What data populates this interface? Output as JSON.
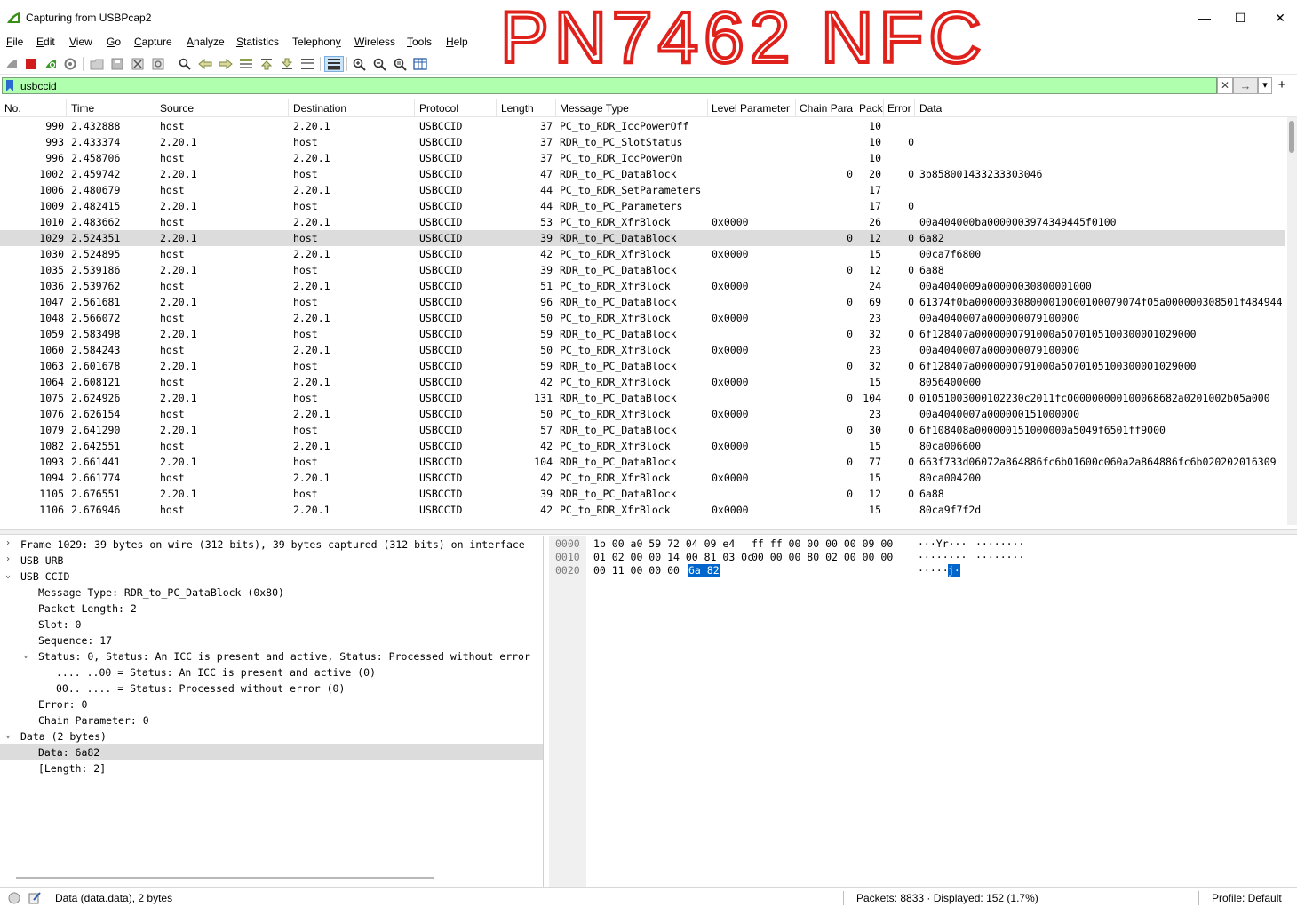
{
  "window": {
    "title": "Capturing from USBPcap2",
    "minimize_glyph": "—",
    "maximize_glyph": "☐",
    "close_glyph": "✕",
    "annotation": "PN7462 NFC"
  },
  "menu": {
    "items": [
      {
        "key": "F",
        "rest": "ile"
      },
      {
        "key": "E",
        "rest": "dit"
      },
      {
        "key": "V",
        "rest": "iew"
      },
      {
        "key": "G",
        "rest": "o"
      },
      {
        "key": "C",
        "rest": "apture"
      },
      {
        "key": "A",
        "rest": "nalyze"
      },
      {
        "key": "S",
        "rest": "tatistics"
      },
      {
        "key": "",
        "rest": "Telephon",
        "key2": "y"
      },
      {
        "key": "W",
        "rest": "ireless"
      },
      {
        "key": "T",
        "rest": "ools"
      },
      {
        "key": "H",
        "rest": "elp"
      }
    ]
  },
  "toolbar": {
    "icons": [
      "shark-fin-icon",
      "stop-icon",
      "restart-icon",
      "options-gear-icon",
      "open-folder-icon",
      "save-icon",
      "close-file-icon",
      "reload-icon",
      "find-icon",
      "back-icon",
      "forward-icon",
      "goto-icon",
      "first-icon",
      "last-icon",
      "autoscroll-icon",
      "colorize-icon",
      "zoom-in-icon",
      "zoom-out-icon",
      "zoom-normal-icon",
      "resize-columns-icon"
    ]
  },
  "filter": {
    "value": "usbccid",
    "clear_glyph": "✕",
    "apply_glyph": "→",
    "dropdown_glyph": "▾",
    "add_glyph": "+"
  },
  "packet_list": {
    "columns": [
      "No.",
      "Time",
      "Source",
      "Destination",
      "Protocol",
      "Length",
      "Message Type",
      "Level Parameter",
      "Chain Parar",
      "Pack",
      "Error",
      "Data"
    ],
    "rows": [
      {
        "no": "990",
        "time": "2.432888",
        "src": "host",
        "dst": "2.20.1",
        "proto": "USBCCID",
        "len": "37",
        "type": "PC_to_RDR_IccPowerOff",
        "level": "",
        "chain": "",
        "pack": "10",
        "error": "",
        "data": ""
      },
      {
        "no": "993",
        "time": "2.433374",
        "src": "2.20.1",
        "dst": "host",
        "proto": "USBCCID",
        "len": "37",
        "type": "RDR_to_PC_SlotStatus",
        "level": "",
        "chain": "",
        "pack": "10",
        "error": "0",
        "data": ""
      },
      {
        "no": "996",
        "time": "2.458706",
        "src": "host",
        "dst": "2.20.1",
        "proto": "USBCCID",
        "len": "37",
        "type": "PC_to_RDR_IccPowerOn",
        "level": "",
        "chain": "",
        "pack": "10",
        "error": "",
        "data": ""
      },
      {
        "no": "1002",
        "time": "2.459742",
        "src": "2.20.1",
        "dst": "host",
        "proto": "USBCCID",
        "len": "47",
        "type": "RDR_to_PC_DataBlock",
        "level": "",
        "chain": "0",
        "pack": "20",
        "error": "0",
        "data": "3b858001433233303046"
      },
      {
        "no": "1006",
        "time": "2.480679",
        "src": "host",
        "dst": "2.20.1",
        "proto": "USBCCID",
        "len": "44",
        "type": "PC_to_RDR_SetParameters",
        "level": "",
        "chain": "",
        "pack": "17",
        "error": "",
        "data": ""
      },
      {
        "no": "1009",
        "time": "2.482415",
        "src": "2.20.1",
        "dst": "host",
        "proto": "USBCCID",
        "len": "44",
        "type": "RDR_to_PC_Parameters",
        "level": "",
        "chain": "",
        "pack": "17",
        "error": "0",
        "data": ""
      },
      {
        "no": "1010",
        "time": "2.483662",
        "src": "host",
        "dst": "2.20.1",
        "proto": "USBCCID",
        "len": "53",
        "type": "PC_to_RDR_XfrBlock",
        "level": "0x0000",
        "chain": "",
        "pack": "26",
        "error": "",
        "data": "00a404000ba0000003974349445f0100"
      },
      {
        "no": "1029",
        "time": "2.524351",
        "src": "2.20.1",
        "dst": "host",
        "proto": "USBCCID",
        "len": "39",
        "type": "RDR_to_PC_DataBlock",
        "level": "",
        "chain": "0",
        "pack": "12",
        "error": "0",
        "data": "6a82"
      },
      {
        "no": "1030",
        "time": "2.524895",
        "src": "host",
        "dst": "2.20.1",
        "proto": "USBCCID",
        "len": "42",
        "type": "PC_to_RDR_XfrBlock",
        "level": "0x0000",
        "chain": "",
        "pack": "15",
        "error": "",
        "data": "00ca7f6800"
      },
      {
        "no": "1035",
        "time": "2.539186",
        "src": "2.20.1",
        "dst": "host",
        "proto": "USBCCID",
        "len": "39",
        "type": "RDR_to_PC_DataBlock",
        "level": "",
        "chain": "0",
        "pack": "12",
        "error": "0",
        "data": "6a88"
      },
      {
        "no": "1036",
        "time": "2.539762",
        "src": "host",
        "dst": "2.20.1",
        "proto": "USBCCID",
        "len": "51",
        "type": "PC_to_RDR_XfrBlock",
        "level": "0x0000",
        "chain": "",
        "pack": "24",
        "error": "",
        "data": "00a4040009a00000030800001000"
      },
      {
        "no": "1047",
        "time": "2.561681",
        "src": "2.20.1",
        "dst": "host",
        "proto": "USBCCID",
        "len": "96",
        "type": "RDR_to_PC_DataBlock",
        "level": "",
        "chain": "0",
        "pack": "69",
        "error": "0",
        "data": "61374f0ba000000308000010000100079074f05a000000308501f484944"
      },
      {
        "no": "1048",
        "time": "2.566072",
        "src": "host",
        "dst": "2.20.1",
        "proto": "USBCCID",
        "len": "50",
        "type": "PC_to_RDR_XfrBlock",
        "level": "0x0000",
        "chain": "",
        "pack": "23",
        "error": "",
        "data": "00a4040007a000000079100000"
      },
      {
        "no": "1059",
        "time": "2.583498",
        "src": "2.20.1",
        "dst": "host",
        "proto": "USBCCID",
        "len": "59",
        "type": "RDR_to_PC_DataBlock",
        "level": "",
        "chain": "0",
        "pack": "32",
        "error": "0",
        "data": "6f128407a0000000791000a5070105100300001029000"
      },
      {
        "no": "1060",
        "time": "2.584243",
        "src": "host",
        "dst": "2.20.1",
        "proto": "USBCCID",
        "len": "50",
        "type": "PC_to_RDR_XfrBlock",
        "level": "0x0000",
        "chain": "",
        "pack": "23",
        "error": "",
        "data": "00a4040007a000000079100000"
      },
      {
        "no": "1063",
        "time": "2.601678",
        "src": "2.20.1",
        "dst": "host",
        "proto": "USBCCID",
        "len": "59",
        "type": "RDR_to_PC_DataBlock",
        "level": "",
        "chain": "0",
        "pack": "32",
        "error": "0",
        "data": "6f128407a0000000791000a5070105100300001029000"
      },
      {
        "no": "1064",
        "time": "2.608121",
        "src": "host",
        "dst": "2.20.1",
        "proto": "USBCCID",
        "len": "42",
        "type": "PC_to_RDR_XfrBlock",
        "level": "0x0000",
        "chain": "",
        "pack": "15",
        "error": "",
        "data": "8056400000"
      },
      {
        "no": "1075",
        "time": "2.624926",
        "src": "2.20.1",
        "dst": "host",
        "proto": "USBCCID",
        "len": "131",
        "type": "RDR_to_PC_DataBlock",
        "level": "",
        "chain": "0",
        "pack": "104",
        "error": "0",
        "data": "01051003000102230c2011fc000000000100068682a0201002b05a000"
      },
      {
        "no": "1076",
        "time": "2.626154",
        "src": "host",
        "dst": "2.20.1",
        "proto": "USBCCID",
        "len": "50",
        "type": "PC_to_RDR_XfrBlock",
        "level": "0x0000",
        "chain": "",
        "pack": "23",
        "error": "",
        "data": "00a4040007a000000151000000"
      },
      {
        "no": "1079",
        "time": "2.641290",
        "src": "2.20.1",
        "dst": "host",
        "proto": "USBCCID",
        "len": "57",
        "type": "RDR_to_PC_DataBlock",
        "level": "",
        "chain": "0",
        "pack": "30",
        "error": "0",
        "data": "6f108408a000000151000000a5049f6501ff9000"
      },
      {
        "no": "1082",
        "time": "2.642551",
        "src": "host",
        "dst": "2.20.1",
        "proto": "USBCCID",
        "len": "42",
        "type": "PC_to_RDR_XfrBlock",
        "level": "0x0000",
        "chain": "",
        "pack": "15",
        "error": "",
        "data": "80ca006600"
      },
      {
        "no": "1093",
        "time": "2.661441",
        "src": "2.20.1",
        "dst": "host",
        "proto": "USBCCID",
        "len": "104",
        "type": "RDR_to_PC_DataBlock",
        "level": "",
        "chain": "0",
        "pack": "77",
        "error": "0",
        "data": "663f733d06072a864886fc6b01600c060a2a864886fc6b020202016309"
      },
      {
        "no": "1094",
        "time": "2.661774",
        "src": "host",
        "dst": "2.20.1",
        "proto": "USBCCID",
        "len": "42",
        "type": "PC_to_RDR_XfrBlock",
        "level": "0x0000",
        "chain": "",
        "pack": "15",
        "error": "",
        "data": "80ca004200"
      },
      {
        "no": "1105",
        "time": "2.676551",
        "src": "2.20.1",
        "dst": "host",
        "proto": "USBCCID",
        "len": "39",
        "type": "RDR_to_PC_DataBlock",
        "level": "",
        "chain": "0",
        "pack": "12",
        "error": "0",
        "data": "6a88"
      },
      {
        "no": "1106",
        "time": "2.676946",
        "src": "host",
        "dst": "2.20.1",
        "proto": "USBCCID",
        "len": "42",
        "type": "PC_to_RDR_XfrBlock",
        "level": "0x0000",
        "chain": "",
        "pack": "15",
        "error": "",
        "data": "80ca9f7f2d"
      }
    ]
  },
  "details": {
    "lines": [
      {
        "indent": 0,
        "arrow": "›",
        "text": "Frame 1029: 39 bytes on wire (312 bits), 39 bytes captured (312 bits) on interface"
      },
      {
        "indent": 0,
        "arrow": "›",
        "text": "USB URB"
      },
      {
        "indent": 0,
        "arrow": "⌄",
        "text": "USB CCID"
      },
      {
        "indent": 1,
        "arrow": "",
        "text": "Message Type: RDR_to_PC_DataBlock (0x80)"
      },
      {
        "indent": 1,
        "arrow": "",
        "text": "Packet Length: 2"
      },
      {
        "indent": 1,
        "arrow": "",
        "text": "Slot: 0"
      },
      {
        "indent": 1,
        "arrow": "",
        "text": "Sequence: 17"
      },
      {
        "indent": 1,
        "arrow": "⌄",
        "text": "Status: 0, Status: An ICC is present and active, Status: Processed without error"
      },
      {
        "indent": 2,
        "arrow": "",
        "text": ".... ..00 = Status: An ICC is present and active (0)"
      },
      {
        "indent": 2,
        "arrow": "",
        "text": "00.. .... = Status: Processed without error  (0)"
      },
      {
        "indent": 1,
        "arrow": "",
        "text": "Error: 0"
      },
      {
        "indent": 1,
        "arrow": "",
        "text": "Chain Parameter: 0"
      },
      {
        "indent": 0,
        "arrow": "⌄",
        "text": "Data (2 bytes)"
      },
      {
        "indent": 1,
        "arrow": "",
        "text": "Data: 6a82"
      },
      {
        "indent": 1,
        "arrow": "",
        "text": "[Length: 2]"
      }
    ]
  },
  "bytes": {
    "rows": [
      {
        "offset": "0000",
        "hex1": "1b 00 a0 59 72 04 09 e4",
        "hex2": "ff ff 00 00 00 00 09 00",
        "ascii1": "···Yr···",
        "ascii2": "········",
        "hl_hex": "",
        "hl_ascii": ""
      },
      {
        "offset": "0010",
        "hex1": "01 02 00 00 14 00 81 03 0c",
        "hex2": "00 00 00 80 02 00 00 00",
        "ascii1": "········",
        "ascii2": "········",
        "hl_hex": "",
        "hl_ascii": ""
      },
      {
        "offset": "0020",
        "hex1": "00 11 00 00 00 ",
        "hex2": "",
        "ascii1": "·····",
        "ascii2": "",
        "hl_hex": "6a 82",
        "hl_ascii": "j·"
      }
    ]
  },
  "status": {
    "field_info": "Data (data.data), 2 bytes",
    "packets": "Packets: 8833 · Displayed: 152 (1.7%)",
    "profile": "Profile: Default"
  }
}
